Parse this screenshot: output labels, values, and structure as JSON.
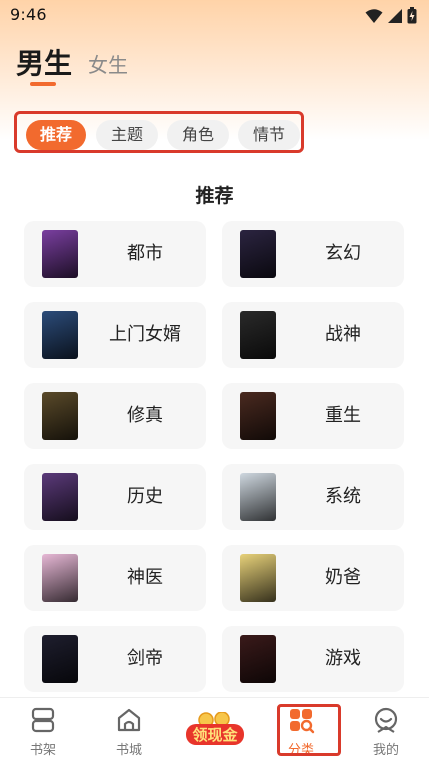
{
  "status": {
    "time": "9:46"
  },
  "gender": {
    "male": "男生",
    "female": "女生"
  },
  "subtabs": [
    {
      "label": "推荐",
      "active": true
    },
    {
      "label": "主题",
      "active": false
    },
    {
      "label": "角色",
      "active": false
    },
    {
      "label": "情节",
      "active": false
    }
  ],
  "section": {
    "title": "推荐"
  },
  "categories": [
    {
      "label": "都市",
      "cover_color": "#7a3fa0"
    },
    {
      "label": "玄幻",
      "cover_color": "#2b2440"
    },
    {
      "label": "上门女婿",
      "cover_color": "#2c4c7a"
    },
    {
      "label": "战神",
      "cover_color": "#2a2a2a"
    },
    {
      "label": "修真",
      "cover_color": "#5a4a2a"
    },
    {
      "label": "重生",
      "cover_color": "#4a2a20"
    },
    {
      "label": "历史",
      "cover_color": "#5b3a7a"
    },
    {
      "label": "系统",
      "cover_color": "#cfd8e0"
    },
    {
      "label": "神医",
      "cover_color": "#e7b8d6"
    },
    {
      "label": "奶爸",
      "cover_color": "#e8d27a"
    },
    {
      "label": "剑帝",
      "cover_color": "#1e1e2e"
    },
    {
      "label": "游戏",
      "cover_color": "#3a1a1a"
    }
  ],
  "nav": {
    "bookshelf": "书架",
    "bookstore": "书城",
    "cash": "领现金",
    "category": "分类",
    "mine": "我的"
  },
  "colors": {
    "accent": "#f26a2e",
    "highlight_box": "#d93a2b"
  }
}
